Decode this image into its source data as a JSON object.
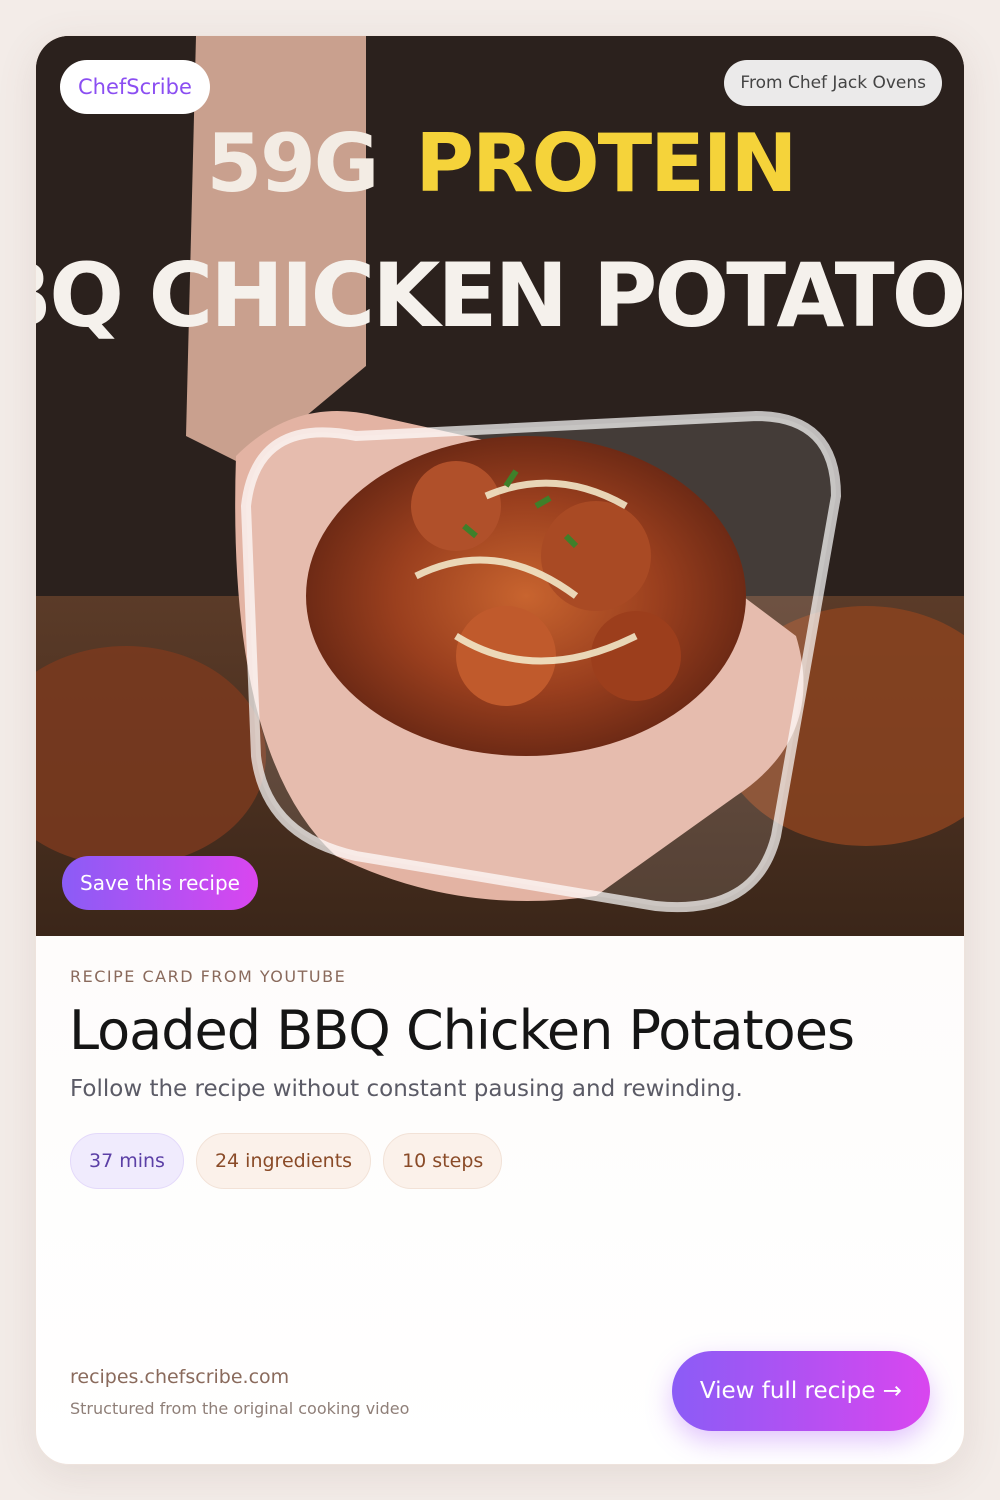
{
  "hero": {
    "image_overlay_line1_a": "59G",
    "image_overlay_line1_b": "PROTEIN",
    "image_overlay_line2": "BBQ CHICKEN POTATOES",
    "brand_label": "ChefScribe",
    "chef_label": "From Chef Jack Ovens",
    "save_label": "Save this recipe"
  },
  "recipe": {
    "eyebrow": "RECIPE CARD FROM YOUTUBE",
    "title": "Loaded BBQ Chicken Potatoes",
    "subtitle": "Follow the recipe without constant pausing and rewinding.",
    "chips": {
      "time": "37 mins",
      "ingredients": "24 ingredients",
      "steps": "10 steps"
    }
  },
  "footer": {
    "domain": "recipes.chefscribe.com",
    "note": "Structured from the original cooking video",
    "cta_label": "View full recipe →"
  },
  "colors": {
    "accent_start": "#8b5cf6",
    "accent_end": "#d946ef",
    "overlay_yellow": "#f5d33a"
  }
}
